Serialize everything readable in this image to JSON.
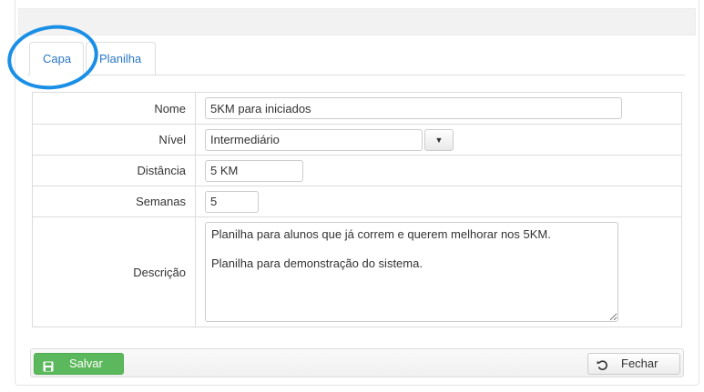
{
  "tabs": [
    {
      "label": "Capa"
    },
    {
      "label": "Planilha"
    }
  ],
  "form": {
    "nome_label": "Nome",
    "nome_value": "5KM para iniciados",
    "nivel_label": "Nível",
    "nivel_value": "Intermediário",
    "distancia_label": "Distância",
    "distancia_value": "5 KM",
    "semanas_label": "Semanas",
    "semanas_value": "5",
    "descricao_label": "Descrição",
    "descricao_value": "Planilha para alunos que já correm e querem melhorar nos 5KM.\n\nPlanilha para demonstração do sistema."
  },
  "footer": {
    "save_label": "Salvar",
    "close_label": "Fechar"
  },
  "icons": {
    "save": "floppy-disk-icon",
    "close": "undo-icon",
    "dropdown": "caret-down-icon"
  },
  "colors": {
    "accent": "#2a76c6",
    "save_button": "#5cb85c",
    "annotation_circle": "#1a8fe6"
  }
}
